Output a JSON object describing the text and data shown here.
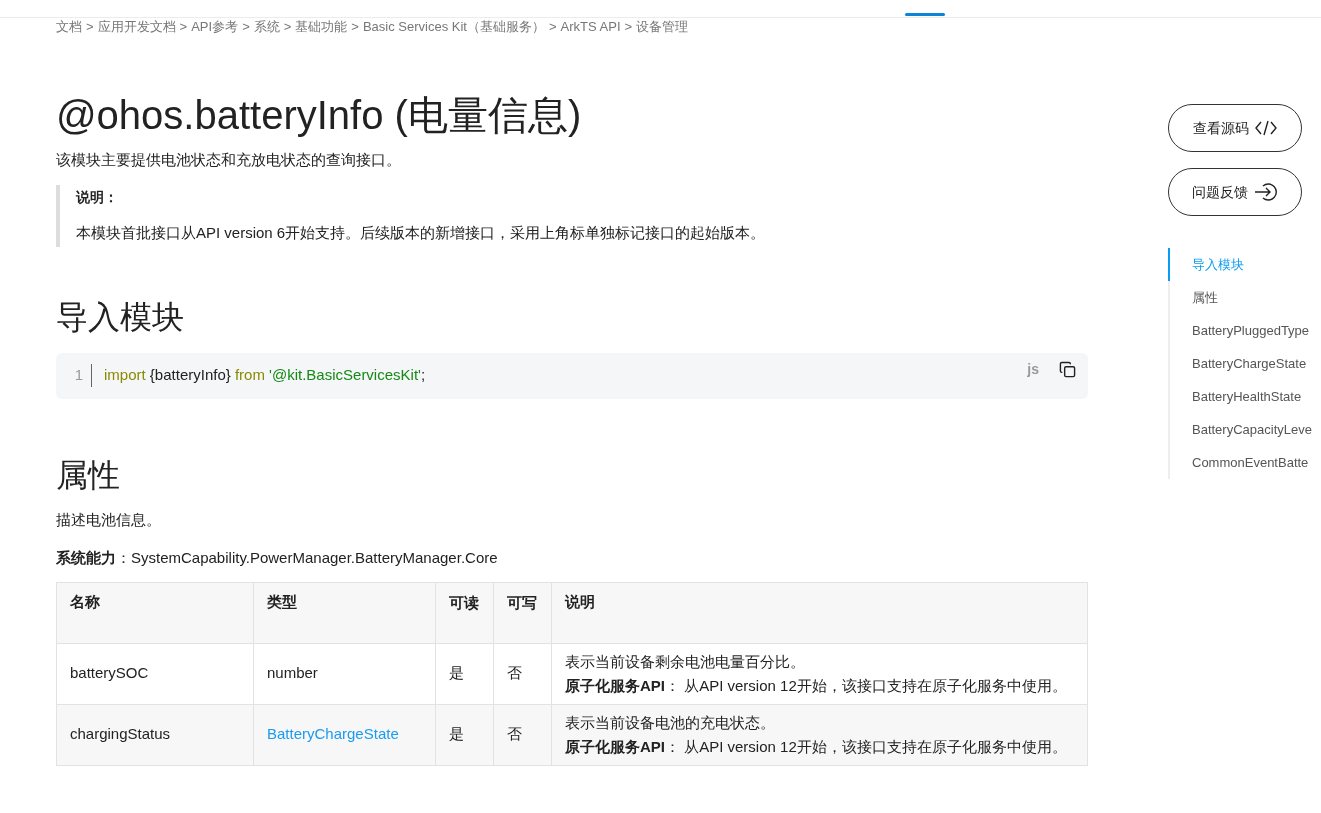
{
  "breadcrumb": {
    "separator": ">",
    "items": [
      "文档",
      "应用开发文档",
      "API参考",
      "系统",
      "基础功能",
      "Basic Services Kit（基础服务）",
      "ArkTS API",
      "设备管理"
    ]
  },
  "title": "@ohos.batteryInfo (电量信息)",
  "intro": "该模块主要提供电池状态和充放电状态的查询接口。",
  "note": {
    "label": "说明：",
    "text": "本模块首批接口从API version 6开始支持。后续版本的新增接口，采用上角标单独标记接口的起始版本。"
  },
  "sections": [
    {
      "heading": "导入模块",
      "code": {
        "language": "js",
        "lines": [
          {
            "number": "1",
            "tokens": [
              {
                "text": "import",
                "kind": "keyword"
              },
              {
                "text": " {batteryInfo} ",
                "kind": "plain"
              },
              {
                "text": "from ",
                "kind": "keyword"
              },
              {
                "text": "'@kit.BasicServicesKit'",
                "kind": "string"
              },
              {
                "text": ";",
                "kind": "plain"
              }
            ]
          }
        ]
      }
    },
    {
      "heading": "属性",
      "description": "描述电池信息。",
      "capability": {
        "label": "系统能力",
        "value": "：SystemCapability.PowerManager.BatteryManager.Core"
      },
      "table": {
        "columns": [
          "名称",
          "类型",
          "可读",
          "可写",
          "说明"
        ],
        "rows": [
          {
            "name": "batterySOC",
            "type": {
              "text": "number",
              "kind": "text"
            },
            "readable": "是",
            "writable": "否",
            "description": [
              "表示当前设备剩余电池电量百分比。",
              "**原子化服务API**：  从API version 12开始，该接口支持在原子化服务中使用。"
            ]
          },
          {
            "name": "chargingStatus",
            "type": {
              "text": "BatteryChargeState",
              "kind": "link"
            },
            "readable": "是",
            "writable": "否",
            "description": [
              "表示当前设备电池的充电状态。",
              "**原子化服务API**：  从API version 12开始，该接口支持在原子化服务中使用。"
            ]
          }
        ]
      }
    }
  ],
  "actions": [
    {
      "label": "查看源码",
      "kind": "code"
    },
    {
      "label": "问题反馈",
      "kind": "feedback"
    }
  ],
  "toc": [
    {
      "label": "导入模块",
      "selected": true
    },
    {
      "label": "属性",
      "selected": false
    },
    {
      "label": "BatteryPluggedType",
      "selected": false
    },
    {
      "label": "BatteryChargeState",
      "selected": false
    },
    {
      "label": "BatteryHealthState",
      "selected": false
    },
    {
      "label": "BatteryCapacityLeve",
      "selected": false
    },
    {
      "label": "CommonEventBatte",
      "selected": false
    }
  ]
}
